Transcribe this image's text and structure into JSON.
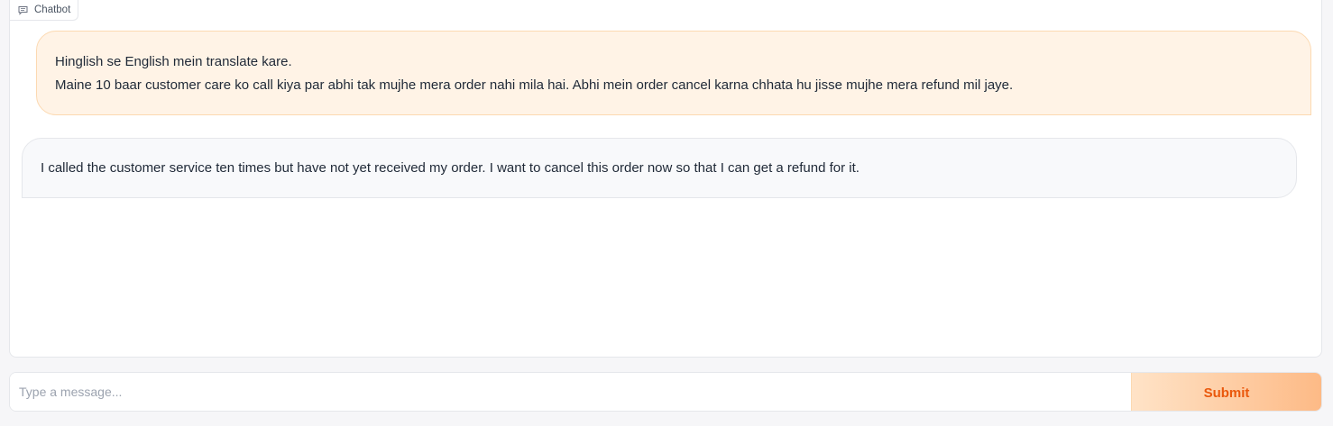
{
  "chatbot": {
    "label": "Chatbot",
    "icon": "chat-bubble-icon",
    "messages": [
      {
        "role": "user",
        "lines": [
          "Hinglish se English mein translate kare.",
          "Maine 10 baar customer care ko call kiya par abhi tak mujhe mera order nahi mila hai. Abhi mein order cancel karna chhata hu jisse mujhe mera refund mil jaye."
        ]
      },
      {
        "role": "bot",
        "lines": [
          "I called the customer service ten times but have not yet received my order. I want to cancel this order now so that I can get a refund for it."
        ]
      }
    ]
  },
  "composer": {
    "value": "",
    "placeholder": "Type a message...",
    "submit_label": "Submit"
  },
  "colors": {
    "accent": "#ea580c",
    "user_bubble": "#fff3e6",
    "bot_bubble": "#f8f9fb"
  }
}
